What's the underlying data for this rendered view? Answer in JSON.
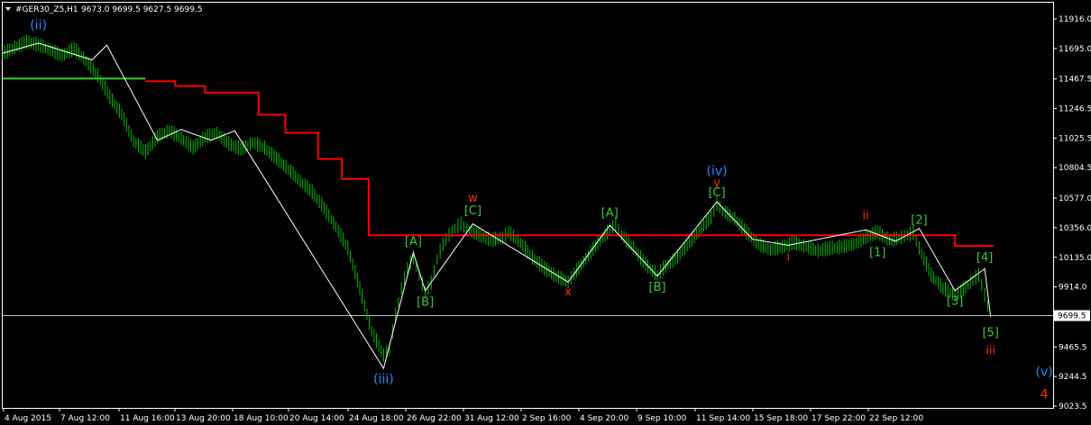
{
  "header": {
    "symbol": "#GER30_Z5,H1",
    "ohlc": "9673.0 9699.5 9627.5 9699.5",
    "menu_icon": "triangle-down-icon"
  },
  "chart_data": {
    "type": "line",
    "y_ticks": [
      "11916.0",
      "11695.0",
      "11467.5",
      "11246.5",
      "11025.5",
      "10804.5",
      "10577.0",
      "10356.0",
      "10135.0",
      "9914.0",
      "9699.5",
      "9465.5",
      "9244.5",
      "9023.5"
    ],
    "y_tick_values": [
      11916.0,
      11695.0,
      11467.5,
      11246.5,
      11025.5,
      10804.5,
      10577.0,
      10356.0,
      10135.0,
      9914.0,
      9699.5,
      9465.5,
      9244.5,
      9023.5
    ],
    "ylim": [
      9023.5,
      11916.0
    ],
    "x_tick_labels": [
      "4 Aug 2015",
      "7 Aug 12:00",
      "11 Aug 16:00",
      "13 Aug 20:00",
      "18 Aug 10:00",
      "20 Aug 14:00",
      "24 Aug 18:00",
      "26 Aug 22:00",
      "31 Aug 12:00",
      "2 Sep 16:00",
      "4 Sep 20:00",
      "9 Sep 10:00",
      "11 Sep 14:00",
      "15 Sep 18:00",
      "17 Sep 22:00",
      "22 Sep 12:00"
    ],
    "current_price": {
      "value": 9699.5,
      "label": "9699.5"
    },
    "colors": {
      "background": "#000000",
      "price": "#00c000",
      "wave": "#ffffff",
      "stop": "#ff0000",
      "ma": "#33cc33",
      "label_blue": "#1e90ff",
      "label_green": "#33cc33",
      "label_red": "#ff3300",
      "axis_text": "#ffffff",
      "grid_line": "#c0c0c0"
    },
    "price_series": [
      [
        0,
        11650
      ],
      [
        4,
        11700
      ],
      [
        8,
        11740
      ],
      [
        12,
        11720
      ],
      [
        16,
        11680
      ],
      [
        20,
        11640
      ],
      [
        24,
        11690
      ],
      [
        28,
        11600
      ],
      [
        32,
        11490
      ],
      [
        36,
        11330
      ],
      [
        40,
        11200
      ],
      [
        44,
        11000
      ],
      [
        48,
        10920
      ],
      [
        52,
        11030
      ],
      [
        56,
        11080
      ],
      [
        60,
        11020
      ],
      [
        64,
        10950
      ],
      [
        68,
        11030
      ],
      [
        72,
        11060
      ],
      [
        76,
        10980
      ],
      [
        80,
        10940
      ],
      [
        84,
        10990
      ],
      [
        88,
        10950
      ],
      [
        92,
        10870
      ],
      [
        96,
        10790
      ],
      [
        100,
        10700
      ],
      [
        104,
        10620
      ],
      [
        108,
        10500
      ],
      [
        112,
        10360
      ],
      [
        116,
        10200
      ],
      [
        120,
        9900
      ],
      [
        124,
        9580
      ],
      [
        128,
        9400
      ],
      [
        130,
        9450
      ],
      [
        132,
        9700
      ],
      [
        134,
        9900
      ],
      [
        136,
        10050
      ],
      [
        138,
        10130
      ],
      [
        140,
        10000
      ],
      [
        142,
        9870
      ],
      [
        144,
        9940
      ],
      [
        146,
        10120
      ],
      [
        148,
        10230
      ],
      [
        150,
        10300
      ],
      [
        152,
        10350
      ],
      [
        154,
        10380
      ],
      [
        156,
        10340
      ],
      [
        160,
        10300
      ],
      [
        164,
        10260
      ],
      [
        168,
        10280
      ],
      [
        170,
        10320
      ],
      [
        174,
        10240
      ],
      [
        178,
        10130
      ],
      [
        182,
        10050
      ],
      [
        186,
        9990
      ],
      [
        190,
        9950
      ],
      [
        192,
        10010
      ],
      [
        196,
        10120
      ],
      [
        200,
        10240
      ],
      [
        204,
        10340
      ],
      [
        206,
        10380
      ],
      [
        208,
        10300
      ],
      [
        212,
        10200
      ],
      [
        216,
        10080
      ],
      [
        220,
        10000
      ],
      [
        222,
        10050
      ],
      [
        226,
        10120
      ],
      [
        230,
        10220
      ],
      [
        234,
        10330
      ],
      [
        238,
        10430
      ],
      [
        240,
        10530
      ],
      [
        242,
        10480
      ],
      [
        246,
        10420
      ],
      [
        250,
        10320
      ],
      [
        254,
        10230
      ],
      [
        258,
        10190
      ],
      [
        262,
        10210
      ],
      [
        266,
        10240
      ],
      [
        270,
        10210
      ],
      [
        274,
        10180
      ],
      [
        278,
        10200
      ],
      [
        282,
        10210
      ],
      [
        286,
        10230
      ],
      [
        290,
        10280
      ],
      [
        294,
        10320
      ],
      [
        298,
        10260
      ],
      [
        302,
        10280
      ],
      [
        304,
        10300
      ],
      [
        306,
        10310
      ],
      [
        308,
        10200
      ],
      [
        312,
        10000
      ],
      [
        316,
        9900
      ],
      [
        320,
        9850
      ],
      [
        322,
        9880
      ],
      [
        326,
        9960
      ],
      [
        328,
        10000
      ],
      [
        330,
        9850
      ],
      [
        332,
        9690
      ]
    ],
    "wave_line": [
      [
        0,
        11660
      ],
      [
        12,
        11735
      ],
      [
        30,
        11610
      ],
      [
        35,
        11720
      ],
      [
        52,
        11010
      ],
      [
        60,
        11090
      ],
      [
        70,
        11010
      ],
      [
        78,
        11080
      ],
      [
        128,
        9305
      ],
      [
        138,
        10170
      ],
      [
        142,
        9885
      ],
      [
        158,
        10385
      ],
      [
        190,
        9950
      ],
      [
        204,
        10375
      ],
      [
        220,
        9995
      ],
      [
        240,
        10550
      ],
      [
        252,
        10270
      ],
      [
        264,
        10225
      ],
      [
        290,
        10340
      ],
      [
        300,
        10255
      ],
      [
        308,
        10350
      ],
      [
        320,
        9885
      ],
      [
        330,
        10050
      ],
      [
        332,
        9690
      ]
    ],
    "ma_line": [
      [
        0,
        11470
      ],
      [
        48,
        11470
      ]
    ],
    "stop_line": [
      [
        48,
        11450
      ],
      [
        58,
        11450
      ],
      [
        58,
        11415
      ],
      [
        68,
        11415
      ],
      [
        68,
        11365
      ],
      [
        86,
        11365
      ],
      [
        86,
        11200
      ],
      [
        95,
        11200
      ],
      [
        95,
        11065
      ],
      [
        106,
        11065
      ],
      [
        106,
        10870
      ],
      [
        114,
        10870
      ],
      [
        114,
        10720
      ],
      [
        123,
        10720
      ],
      [
        123,
        10300
      ],
      [
        320,
        10300
      ],
      [
        320,
        10220
      ],
      [
        333,
        10220
      ]
    ],
    "wave_labels": [
      {
        "text": "(ii)",
        "x": 12,
        "y": 11840,
        "color": "label_blue",
        "cls": "lbl"
      },
      {
        "text": "(iii)",
        "x": 128,
        "y": 9195,
        "color": "label_blue",
        "cls": "lbl"
      },
      {
        "text": "[A]",
        "x": 138,
        "y": 10225,
        "color": "label_green",
        "cls": "lbl-small"
      },
      {
        "text": "[B]",
        "x": 142,
        "y": 9775,
        "color": "label_green",
        "cls": "lbl-small"
      },
      {
        "text": "w",
        "x": 158,
        "y": 10550,
        "color": "label_red",
        "cls": "lbl-small"
      },
      {
        "text": "[C]",
        "x": 158,
        "y": 10455,
        "color": "label_green",
        "cls": "lbl-small"
      },
      {
        "text": "x",
        "x": 190,
        "y": 9850,
        "color": "label_red",
        "cls": "lbl-small"
      },
      {
        "text": "[A]",
        "x": 204,
        "y": 10440,
        "color": "label_green",
        "cls": "lbl-small"
      },
      {
        "text": "[B]",
        "x": 220,
        "y": 9885,
        "color": "label_green",
        "cls": "lbl-small"
      },
      {
        "text": "(iv)",
        "x": 240,
        "y": 10750,
        "color": "label_blue",
        "cls": "lbl"
      },
      {
        "text": "y",
        "x": 240,
        "y": 10665,
        "color": "label_red",
        "cls": "lbl-small"
      },
      {
        "text": "[C]",
        "x": 240,
        "y": 10590,
        "color": "label_green",
        "cls": "lbl-small"
      },
      {
        "text": "i",
        "x": 264,
        "y": 10110,
        "color": "label_red",
        "cls": "lbl-small"
      },
      {
        "text": "ii",
        "x": 290,
        "y": 10420,
        "color": "label_red",
        "cls": "lbl-small"
      },
      {
        "text": "[1]",
        "x": 294,
        "y": 10145,
        "color": "label_green",
        "cls": "lbl-small"
      },
      {
        "text": "[2]",
        "x": 308,
        "y": 10385,
        "color": "label_green",
        "cls": "lbl-small"
      },
      {
        "text": "[3]",
        "x": 320,
        "y": 9780,
        "color": "label_green",
        "cls": "lbl-small"
      },
      {
        "text": "[4]",
        "x": 330,
        "y": 10105,
        "color": "label_green",
        "cls": "lbl-small"
      },
      {
        "text": "[5]",
        "x": 332,
        "y": 9545,
        "color": "label_green",
        "cls": "lbl-small"
      },
      {
        "text": "iii",
        "x": 332,
        "y": 9410,
        "color": "label_red",
        "cls": "lbl-small"
      },
      {
        "text": "(v)",
        "x": 350,
        "y": 9250,
        "color": "label_blue",
        "cls": "lbl"
      },
      {
        "text": "4",
        "x": 350,
        "y": 9080,
        "color": "label_red",
        "cls": "lbl"
      }
    ]
  }
}
